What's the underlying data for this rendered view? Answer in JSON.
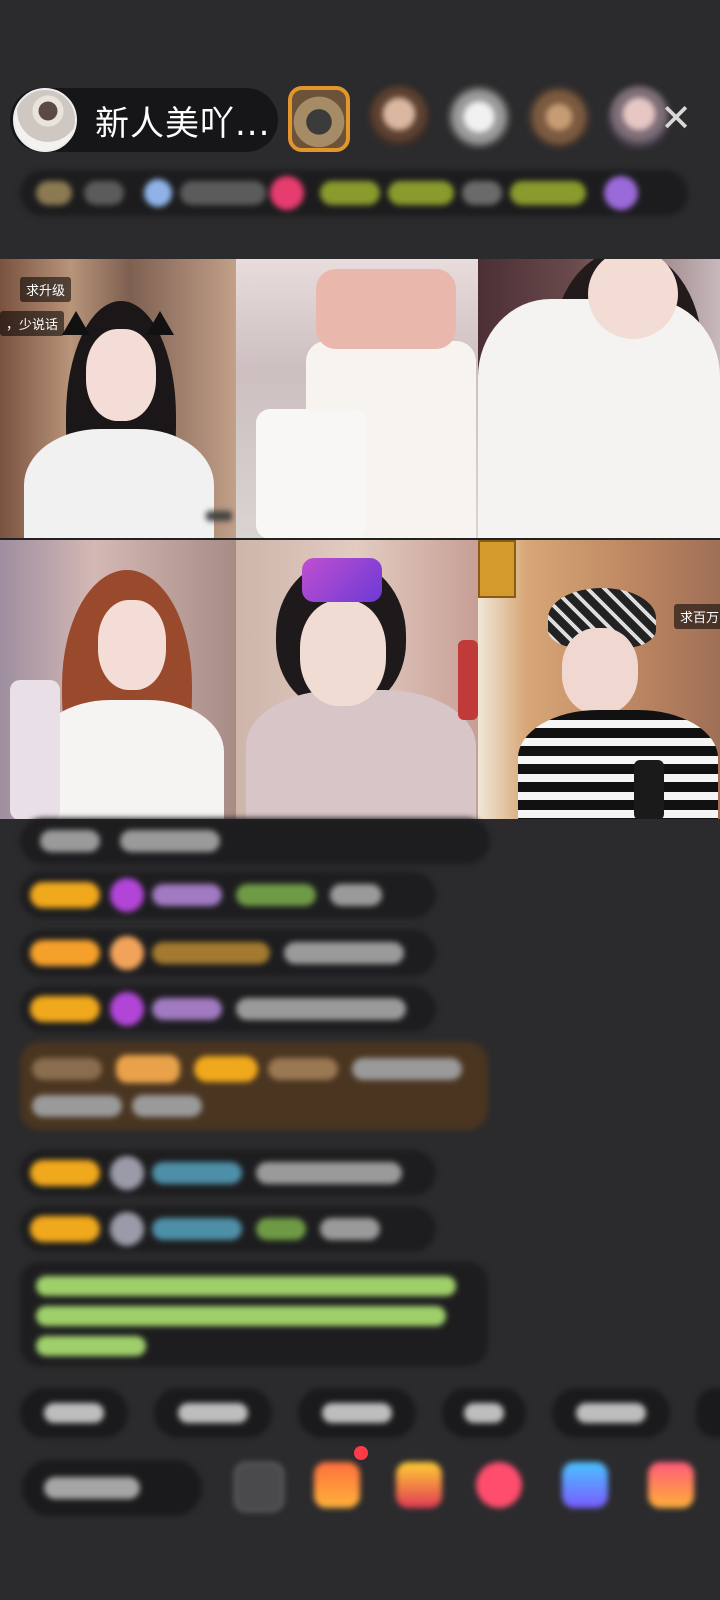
{
  "header": {
    "host_name": "新人美吖...",
    "close_label": "✕"
  },
  "colors": {
    "background": "#2b2b2d",
    "level_badge": "#f0a81c",
    "notification_dot": "#ff3b4a"
  },
  "video_grid": {
    "tiles": [
      {
        "badges": [
          "求升级",
          "，少说话"
        ]
      },
      {
        "badges": []
      },
      {
        "badges": []
      },
      {
        "badges": []
      },
      {
        "badges": []
      },
      {
        "badges": [
          "求百万"
        ]
      }
    ]
  },
  "bottom_bar": {
    "icons": [
      "more-icon",
      "gift-box-icon",
      "treasure-icon",
      "heart-gift-icon",
      "game-icon",
      "shop-icon"
    ]
  }
}
